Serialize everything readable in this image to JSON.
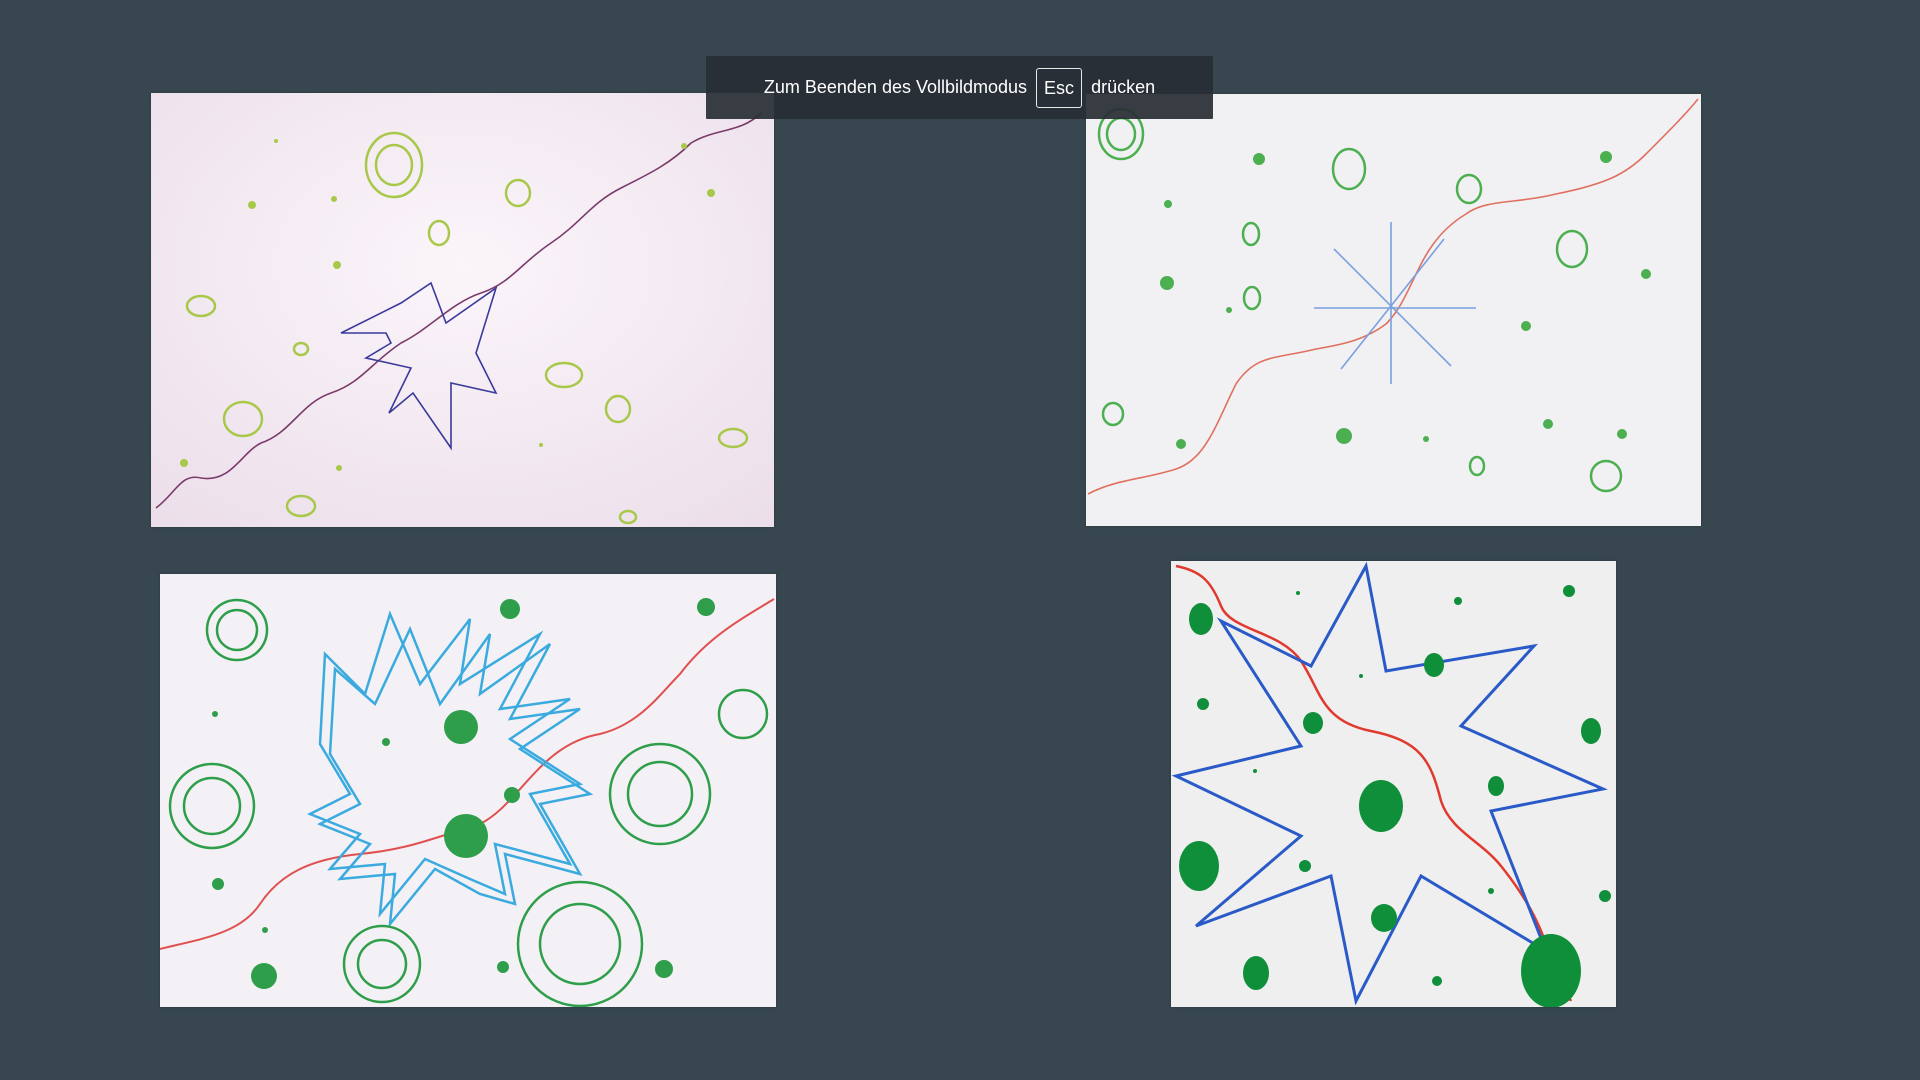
{
  "fullscreen_notice": {
    "text_before": "Zum Beenden des Vollbildmodus",
    "key_label": "Esc",
    "text_after": "drücken"
  },
  "drawings": [
    {
      "id": "drawing-1",
      "description_colors": {
        "paper": "#f6eef4",
        "dots": "#a8c84a",
        "wave": "#7a3a6a",
        "star": "#3a3a9a"
      }
    },
    {
      "id": "drawing-2",
      "description_colors": {
        "paper": "#f2f2f4",
        "dots": "#4caf50",
        "wave": "#e07060",
        "star": "#7aa0e0"
      }
    },
    {
      "id": "drawing-3",
      "description_colors": {
        "paper": "#f4f2f6",
        "dots": "#2e9e4a",
        "wave": "#e05050",
        "star": "#3aaadf"
      }
    },
    {
      "id": "drawing-4",
      "description_colors": {
        "paper": "#f0f0f0",
        "dots": "#0f8f3a",
        "wave": "#e03a2e",
        "star": "#2a5ac8"
      }
    }
  ],
  "colors": {
    "background": "#37464f",
    "toast": "#282e34"
  }
}
